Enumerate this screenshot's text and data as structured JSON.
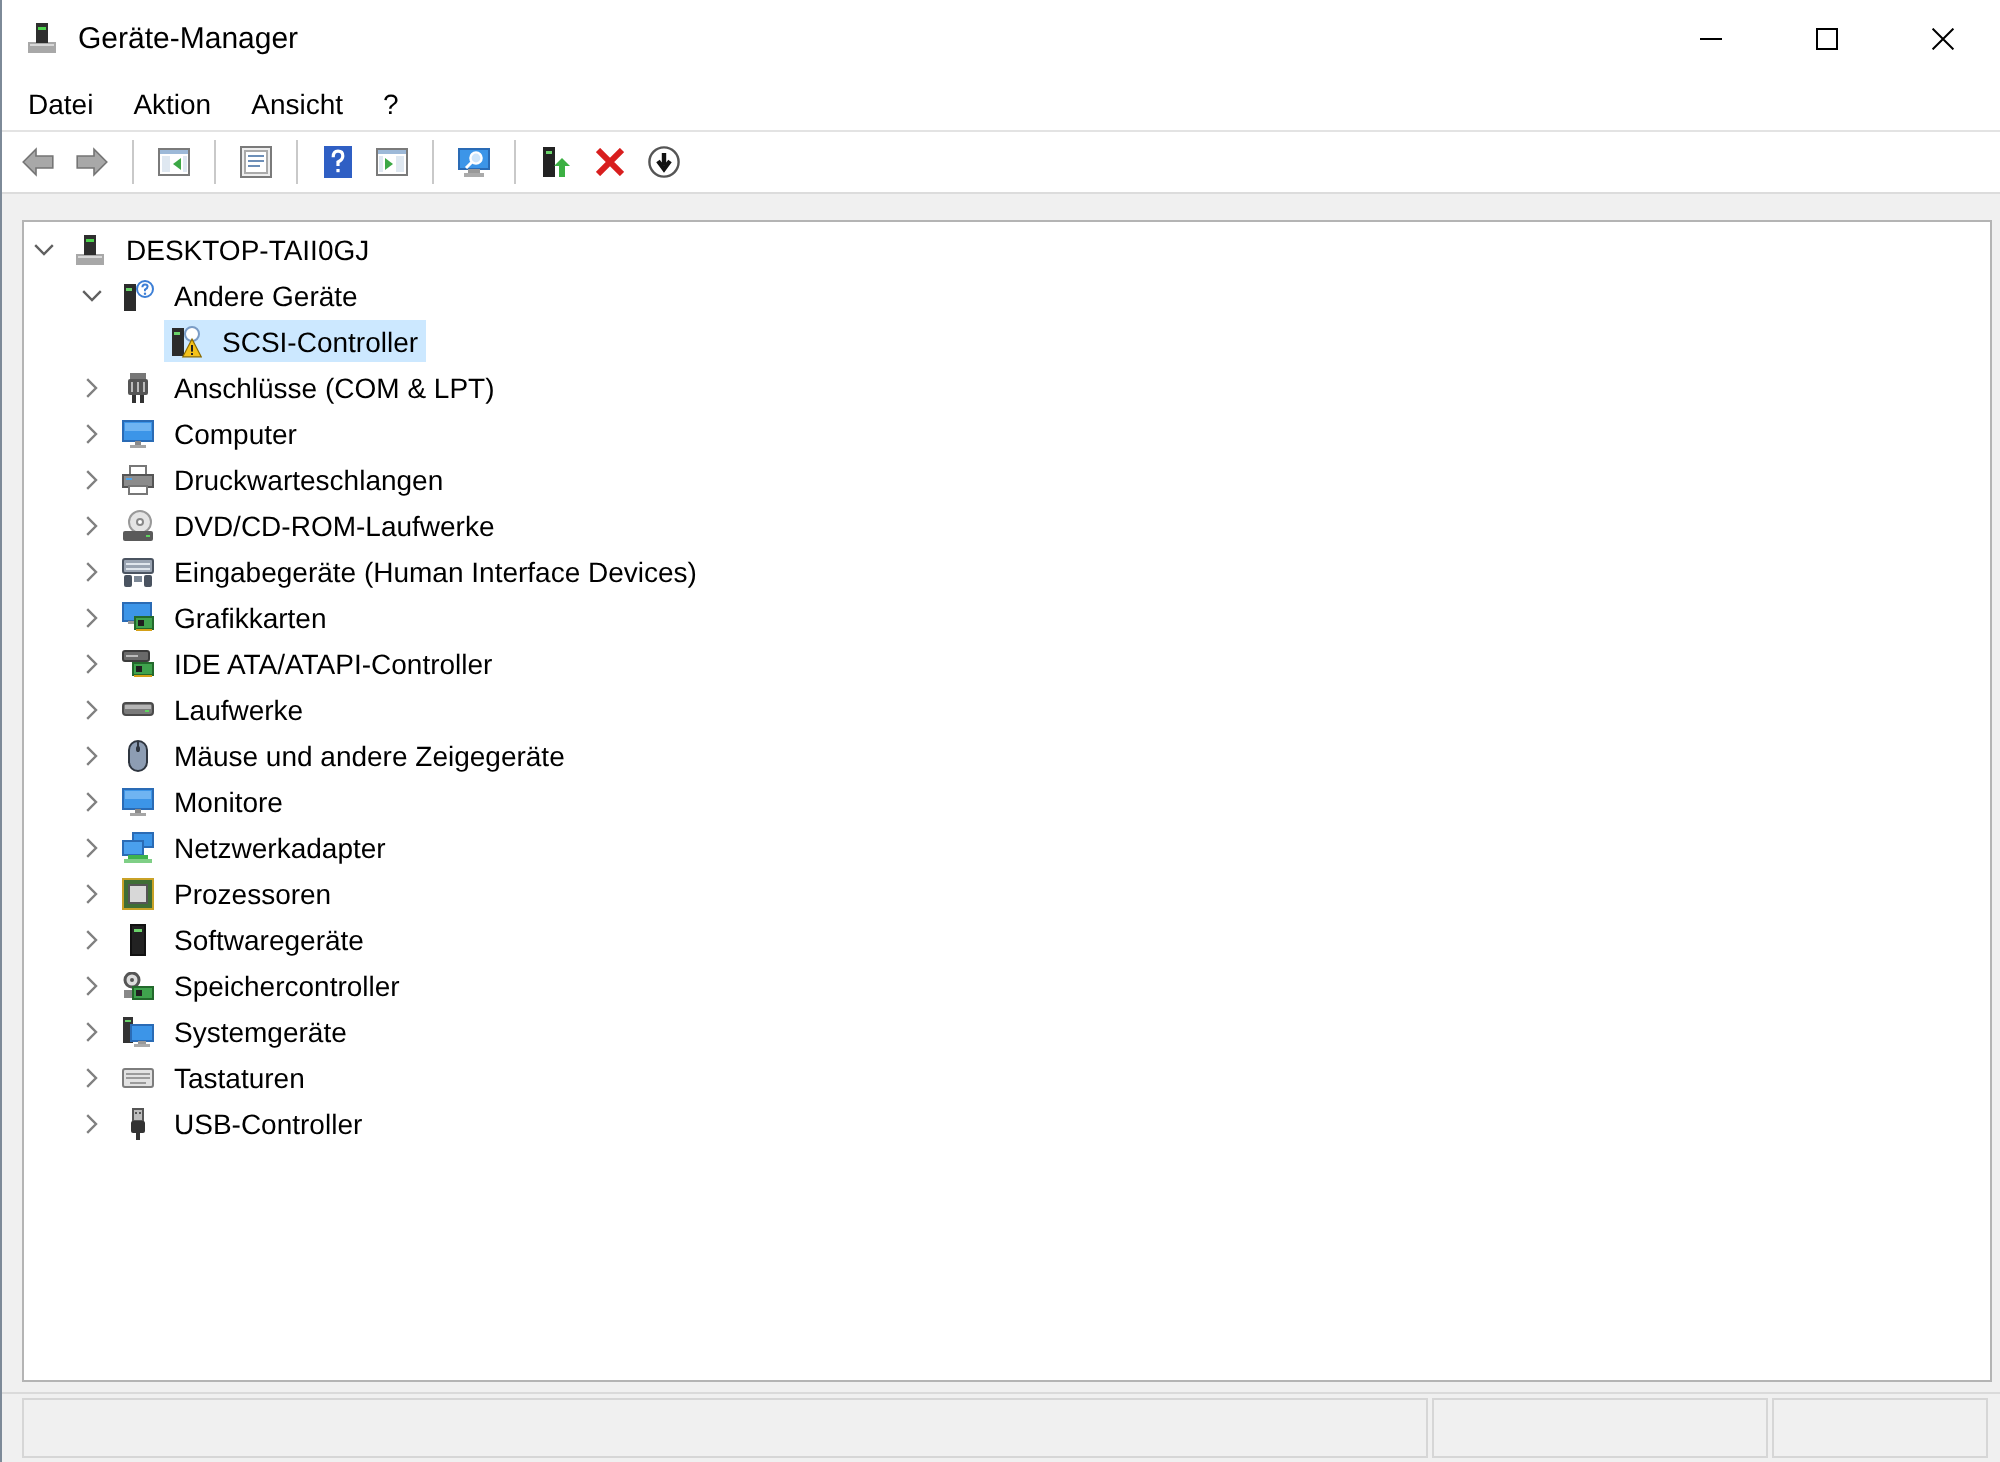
{
  "window": {
    "title": "Geräte-Manager"
  },
  "menu": [
    "Datei",
    "Aktion",
    "Ansicht",
    "?"
  ],
  "toolbar": {
    "buttons": [
      {
        "disabled": true
      },
      {
        "disabled": true
      },
      {
        "disabled": false
      },
      {
        "disabled": false
      },
      {
        "disabled": false
      },
      {
        "disabled": false
      },
      {
        "disabled": false
      },
      {
        "disabled": false
      },
      {
        "disabled": false
      },
      {
        "disabled": false
      }
    ]
  },
  "tree": {
    "label": "DESKTOP-TAII0GJ",
    "expanded": true,
    "selected": false,
    "children": [
      {
        "label": "Andere Geräte",
        "expanded": true,
        "selected": false,
        "children": [
          {
            "label": "SCSI-Controller",
            "selected": true,
            "problem": true
          }
        ]
      },
      {
        "label": "Anschlüsse (COM & LPT)",
        "expanded": false,
        "selected": false
      },
      {
        "label": "Computer",
        "expanded": false,
        "selected": false
      },
      {
        "label": "Druckwarteschlangen",
        "expanded": false,
        "selected": false
      },
      {
        "label": "DVD/CD-ROM-Laufwerke",
        "expanded": false,
        "selected": false
      },
      {
        "label": "Eingabegeräte (Human Interface Devices)",
        "expanded": false,
        "selected": false
      },
      {
        "label": "Grafikkarten",
        "expanded": false,
        "selected": false
      },
      {
        "label": "IDE ATA/ATAPI-Controller",
        "expanded": false,
        "selected": false
      },
      {
        "label": "Laufwerke",
        "expanded": false,
        "selected": false
      },
      {
        "label": "Mäuse und andere Zeigegeräte",
        "expanded": false,
        "selected": false
      },
      {
        "label": "Monitore",
        "expanded": false,
        "selected": false
      },
      {
        "label": "Netzwerkadapter",
        "expanded": false,
        "selected": false
      },
      {
        "label": "Prozessoren",
        "expanded": false,
        "selected": false
      },
      {
        "label": "Softwaregeräte",
        "expanded": false,
        "selected": false
      },
      {
        "label": "Speichercontroller",
        "expanded": false,
        "selected": false
      },
      {
        "label": "Systemgeräte",
        "expanded": false,
        "selected": false
      },
      {
        "label": "Tastaturen",
        "expanded": false,
        "selected": false
      },
      {
        "label": "USB-Controller",
        "expanded": false,
        "selected": false
      }
    ]
  }
}
